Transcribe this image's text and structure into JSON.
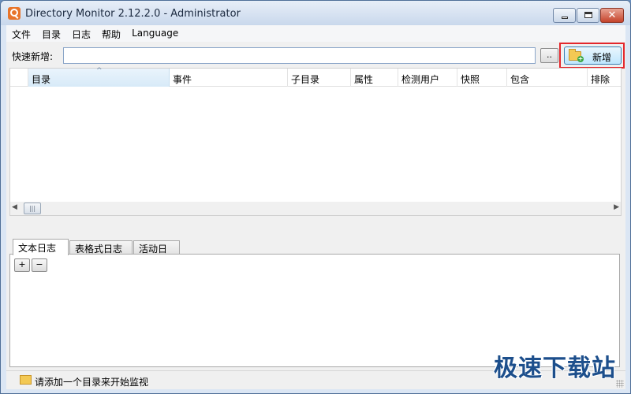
{
  "window": {
    "title": "Directory Monitor 2.12.2.0 - Administrator",
    "minimize_icon": "minimize-icon",
    "maximize_icon": "maximize-icon",
    "close_icon": "close-icon",
    "close_glyph": "✕"
  },
  "menu": {
    "items": [
      "文件",
      "目录",
      "日志",
      "帮助",
      "Language"
    ]
  },
  "quick_add": {
    "label": "快速新增:",
    "input_value": "",
    "browse_label": "..",
    "add_label": "新增",
    "highlight_color": "#e4272c"
  },
  "grid": {
    "columns": [
      "目录",
      "事件",
      "子目录",
      "属性",
      "检测用户",
      "快照",
      "包含",
      "排除"
    ],
    "sorted_column": "目录",
    "sort_arrow": "^",
    "rows": [],
    "scroll_left": "◀",
    "scroll_right": "▶",
    "scroll_thumb": "|||"
  },
  "log": {
    "tabs": [
      "文本日志",
      "表格式日志",
      "活动日志"
    ],
    "active_tab": "文本日志",
    "zoom_in_label": "+",
    "zoom_out_label": "−"
  },
  "status": {
    "text": "请添加一个目录来开始监视",
    "icon": "folder-icon"
  },
  "watermark": "极速下载站"
}
